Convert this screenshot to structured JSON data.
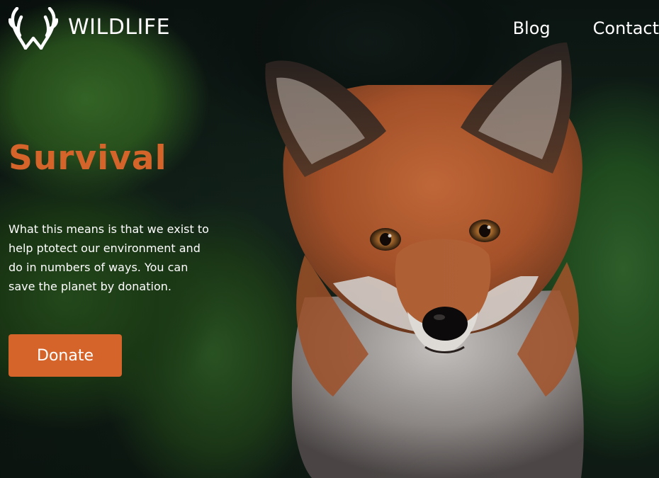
{
  "header": {
    "brand": "WILDLIFE",
    "logo_icon": "antlers-icon",
    "nav": [
      {
        "label": "Blog"
      },
      {
        "label": "Contact"
      }
    ]
  },
  "hero": {
    "headline": "Survival",
    "description": "What this means is that we exist to help ptotect our environment and do in numbers of ways. You can save the planet by donation.",
    "cta_label": "Donate",
    "background_image": "fox-in-foliage"
  },
  "colors": {
    "accent": "#d4642a",
    "text": "#ffffff"
  }
}
